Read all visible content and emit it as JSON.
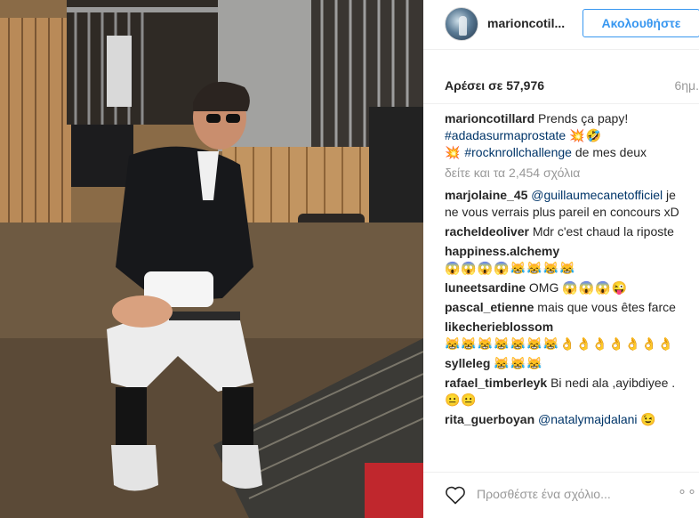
{
  "post": {
    "username": "marioncotil...",
    "follow_label": "Ακολουθήστε",
    "likes_text": "Αρέσει σε 57,976",
    "time_ago": "6ημ.",
    "add_comment_placeholder": "Προσθέστε ένα σχόλιο...",
    "more_label": "∘∘∘"
  },
  "caption": {
    "username": "marioncotillard",
    "text": "Prends ça papy!",
    "hashtag1": "#adadasurmaprostate",
    "emoji1": "💥🤣",
    "emoji2": "💥",
    "hashtag2": "#rocknrollchallenge",
    "text2": "de mes deux"
  },
  "view_all": "δείτε και τα 2,454 σχόλια",
  "comments": [
    {
      "user": "marjolaine_45",
      "mention": "@guillaumecanetofficiel",
      "text": "je ne vous verrais plus pareil en concours xD"
    },
    {
      "user": "racheldeoliver",
      "text": "Mdr c'est chaud la riposte"
    },
    {
      "user": "happiness.alchemy",
      "emoji": "😱😱😱😱😹😹😹😹"
    },
    {
      "user": "luneetsardine",
      "text": "OMG",
      "emoji": "😱😱😱😜"
    },
    {
      "user": "pascal_etienne",
      "text": "mais que vous êtes farce"
    },
    {
      "user": "likecherieblossom",
      "emoji": "😹😹😹😹😹😹😹👌👌👌👌👌👌👌"
    },
    {
      "user": "sylleleg",
      "emoji": "😹😹😹"
    },
    {
      "user": "rafael_timberleyk",
      "text": "Bi nedi ala ,ayibdiyee .",
      "emoji": "😐😐"
    },
    {
      "user": "rita_guerboyan",
      "mention": "@natalymajdalani",
      "emoji": "😉"
    }
  ],
  "colors": {
    "link": "#003569",
    "follow_blue": "#3897f0",
    "muted": "#999999",
    "text": "#262626"
  },
  "icons": {
    "like": "heart-outline-icon",
    "more": "ellipsis-icon"
  }
}
